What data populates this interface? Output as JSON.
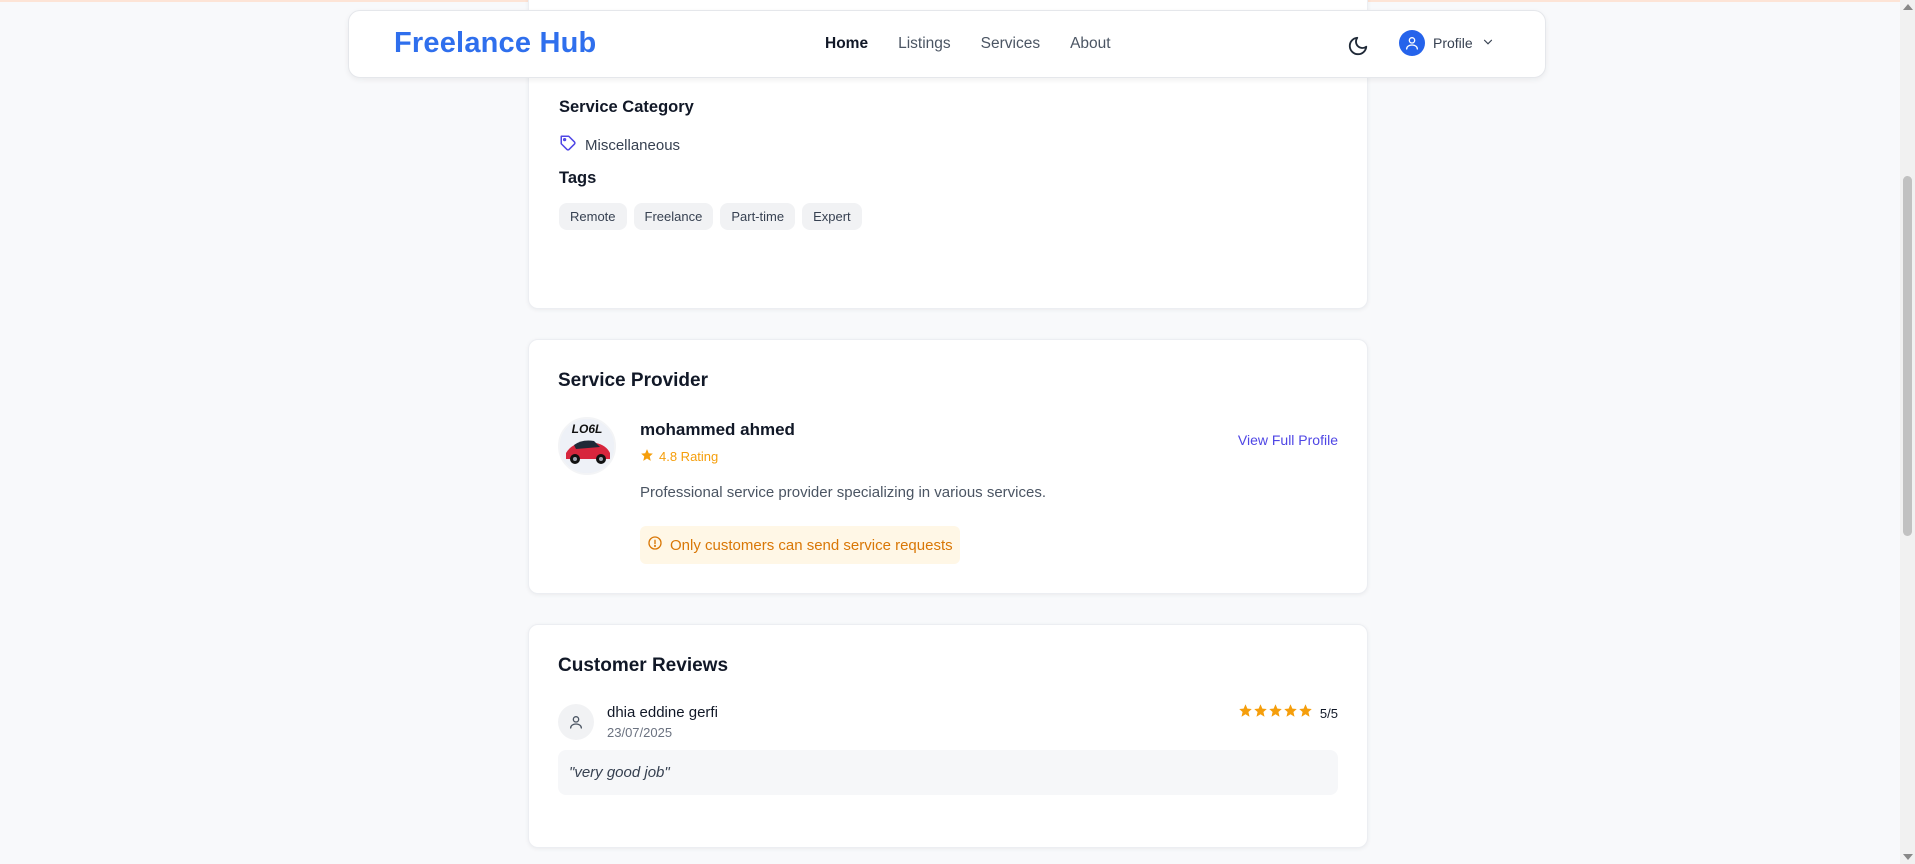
{
  "navbar": {
    "brand": "Freelance Hub",
    "links": [
      "Home",
      "Listings",
      "Services",
      "About"
    ],
    "active_link": "Home",
    "theme_toggle_icon": "moon-icon",
    "profile_label": "Profile"
  },
  "details": {
    "category_heading": "Service Category",
    "category_value": "Miscellaneous",
    "tags_heading": "Tags",
    "tags": [
      "Remote",
      "Freelance",
      "Part-time",
      "Expert"
    ]
  },
  "provider": {
    "title": "Service Provider",
    "name": "mohammed ahmed",
    "rating_text": "4.8 Rating",
    "view_profile_label": "View Full Profile",
    "description": "Professional service provider specializing in various services.",
    "alert_text": "Only customers can send service requests"
  },
  "reviews": {
    "title": "Customer Reviews",
    "items": [
      {
        "name": "dhia eddine gerfi",
        "date": "23/07/2025",
        "stars": 5,
        "score_text": "5/5",
        "text": "\"very good job\""
      }
    ]
  },
  "colors": {
    "brand": "#2f6fed",
    "accent": "#4f46e5",
    "star": "#f59e0b",
    "alert_bg": "#fff7e6",
    "alert_text": "#d97706"
  }
}
